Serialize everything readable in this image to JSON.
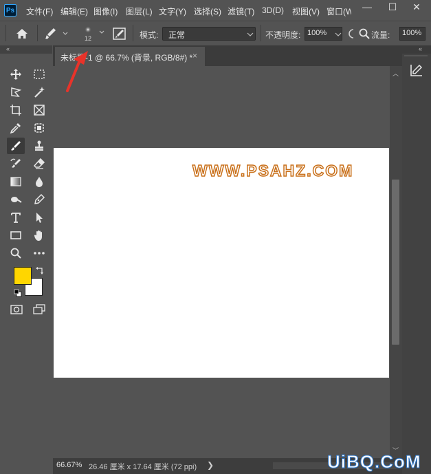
{
  "app": {
    "logo_text": "Ps",
    "menu": [
      "文件(F)",
      "编辑(E)",
      "图像(I)",
      "图层(L)",
      "文字(Y)",
      "选择(S)",
      "滤镜(T)",
      "3D(D)",
      "视图(V)",
      "窗口(W"
    ]
  },
  "window_controls": {
    "minimize": "—",
    "maximize": "☐",
    "close": "✕"
  },
  "options_bar": {
    "brush_size": "12",
    "mode_label": "模式:",
    "mode_value": "正常",
    "opacity_label": "不透明度:",
    "opacity_value": "100%",
    "flow_label": "流量:",
    "flow_value": "100%"
  },
  "document_tab": {
    "title": "未标题-1 @ 66.7% (背景, RGB/8#) *",
    "close": "×"
  },
  "document": {
    "watermark_text": "WWW.PSAHZ.COM"
  },
  "colors": {
    "foreground": "#ffd600",
    "background": "#ffffff",
    "watermark_stroke": "#c9701a",
    "annotation_arrow": "#e8332a"
  },
  "status_bar": {
    "zoom": "66.67%",
    "doc_size": "26.46 厘米 x 17.64 厘米 (72 ppi)",
    "arrow": "❯"
  },
  "site_watermark": "UiBQ.CoM",
  "tools": [
    "move-icon",
    "marquee-icon",
    "lasso-icon",
    "magic-wand-icon",
    "crop-icon",
    "frame-icon",
    "eyedropper-icon",
    "patch-icon",
    "brush-icon",
    "stamp-icon",
    "history-brush-icon",
    "eraser-icon",
    "gradient-icon",
    "blur-icon",
    "dodge-icon",
    "pen-icon",
    "type-icon",
    "path-select-icon",
    "rectangle-icon",
    "hand-icon",
    "zoom-icon",
    "more-icon"
  ]
}
